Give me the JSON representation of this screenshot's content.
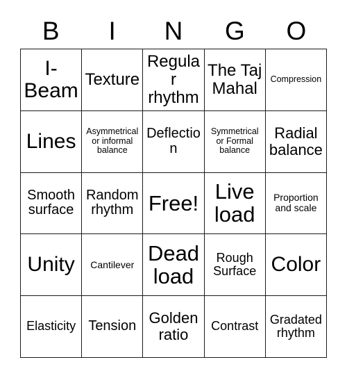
{
  "card": {
    "title": "BINGO",
    "header_letters": [
      "B",
      "I",
      "N",
      "G",
      "O"
    ],
    "rows": 5,
    "columns": 5,
    "border_color": "#1a1a1a",
    "background_color": "#ffffff",
    "text_color": "#000000",
    "free_space": "Free!",
    "cells": [
      [
        {
          "text": "I-Beam",
          "size": "lg"
        },
        {
          "text": "Texture",
          "size": "md"
        },
        {
          "text": "Regular rhythm",
          "size": "md"
        },
        {
          "text": "The Taj Mahal",
          "size": "md"
        },
        {
          "text": "Compression",
          "size": "micro"
        }
      ],
      [
        {
          "text": "Lines",
          "size": "lg"
        },
        {
          "text": "Asymmetrical or informal balance",
          "size": "micro"
        },
        {
          "text": "Deflection",
          "size": "xs"
        },
        {
          "text": "Symmetrical or Formal balance",
          "size": "micro"
        },
        {
          "text": "Radial balance",
          "size": "sm"
        }
      ],
      [
        {
          "text": "Smooth surface",
          "size": "xs"
        },
        {
          "text": "Random rhythm",
          "size": "xs"
        },
        {
          "text": "Free!",
          "size": "xl"
        },
        {
          "text": "Live load",
          "size": "xl"
        },
        {
          "text": "Proportion and scale",
          "size": "tiny"
        }
      ],
      [
        {
          "text": "Unity",
          "size": "lg"
        },
        {
          "text": "Cantilever",
          "size": "tiny"
        },
        {
          "text": "Dead load",
          "size": "xl"
        },
        {
          "text": "Rough Surface",
          "size": "xxs"
        },
        {
          "text": "Color",
          "size": "lg"
        }
      ],
      [
        {
          "text": "Elasticity",
          "size": "xxs"
        },
        {
          "text": "Tension",
          "size": "xs"
        },
        {
          "text": "Golden ratio",
          "size": "sm"
        },
        {
          "text": "Contrast",
          "size": "xxs"
        },
        {
          "text": "Gradated rhythm",
          "size": "xxs"
        }
      ]
    ]
  }
}
